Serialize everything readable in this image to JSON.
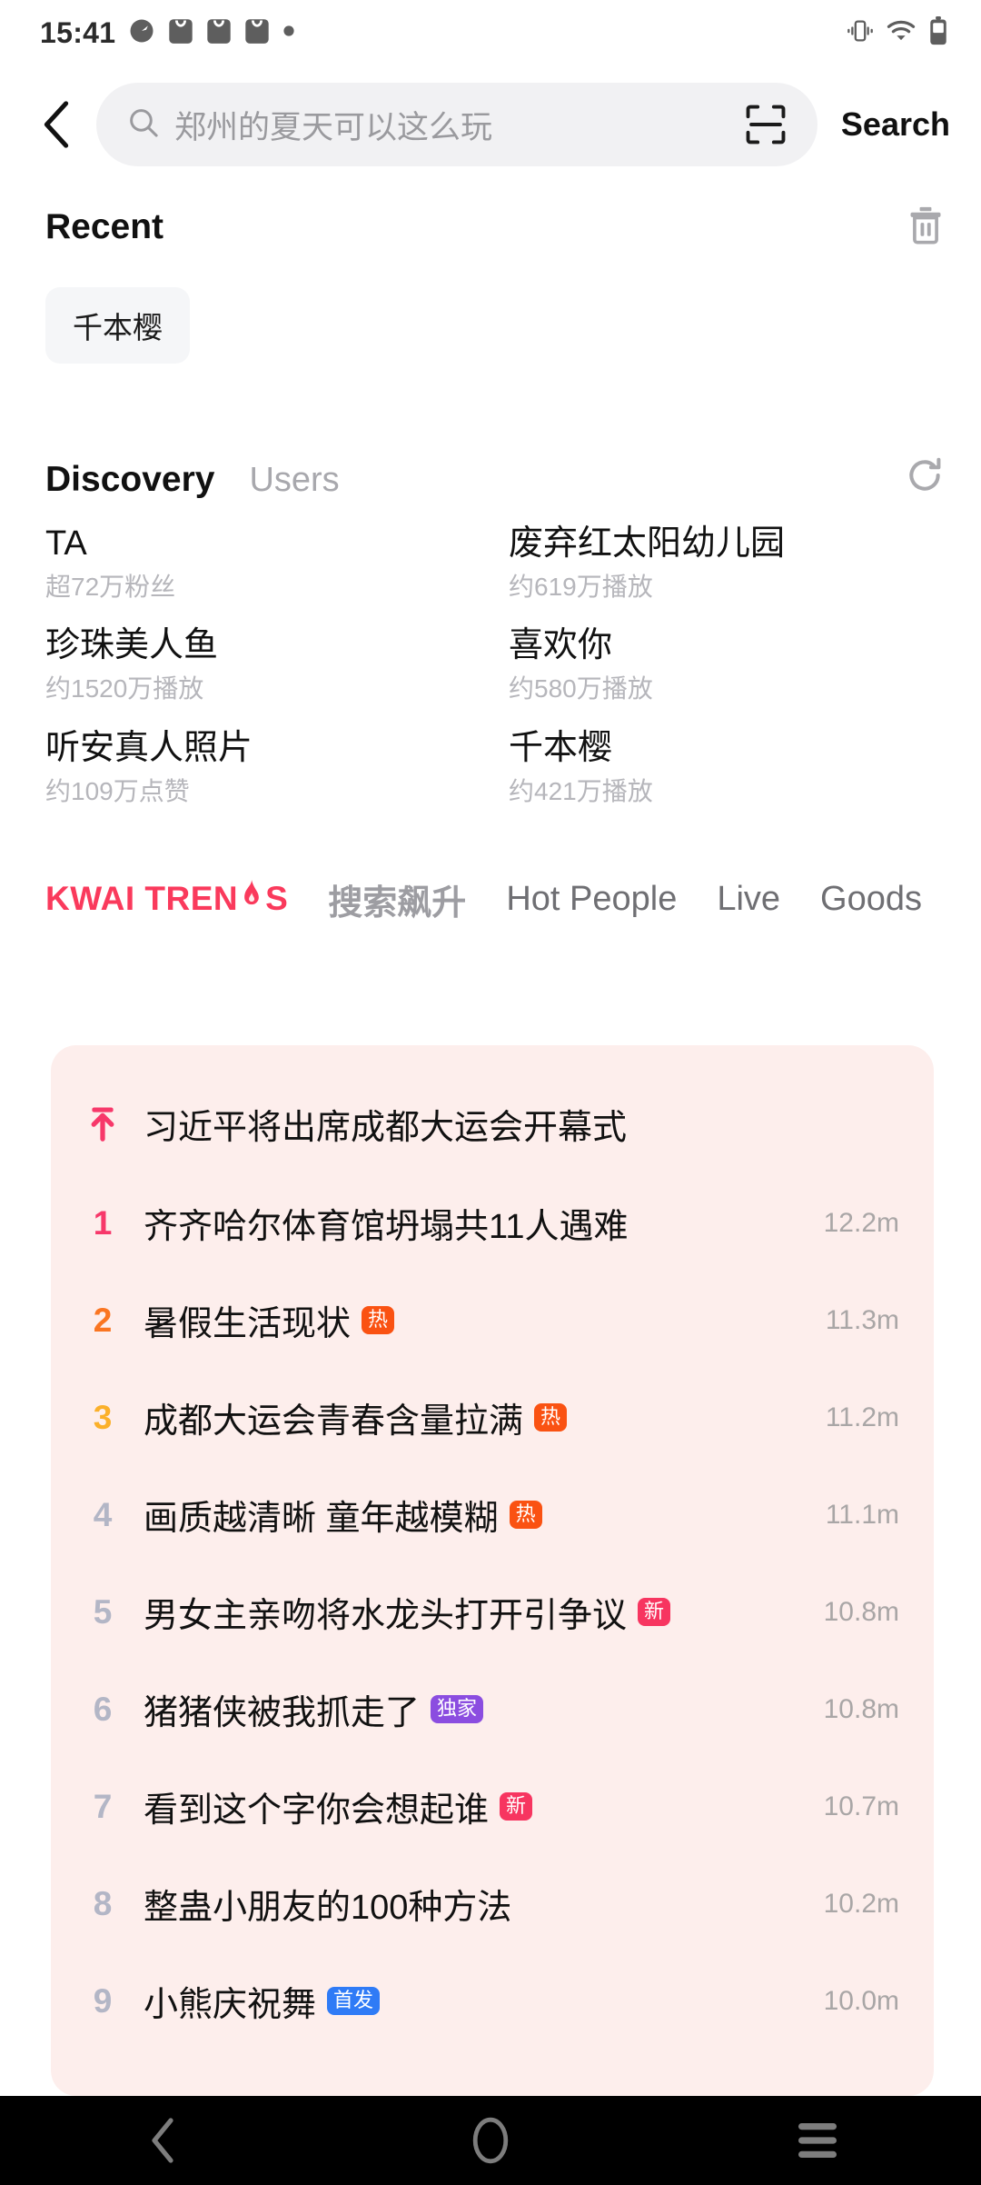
{
  "statusbar": {
    "time": "15:41",
    "left_icons": [
      "speedometer-icon",
      "bag-icon",
      "bag-icon",
      "bag-icon",
      "dot-icon"
    ],
    "right_icons": [
      "vibrate-icon",
      "wifi-icon",
      "battery-icon"
    ]
  },
  "header": {
    "back_icon": "chevron-left-icon",
    "search_icon": "search-icon",
    "search_value": "",
    "search_placeholder": "郑州的夏天可以这么玩",
    "scan_icon": "scan-icon",
    "search_button": "Search"
  },
  "recent": {
    "title": "Recent",
    "clear_icon": "trash-icon",
    "chips": [
      "千本樱"
    ]
  },
  "discovery": {
    "tabs": [
      {
        "label": "Discovery",
        "active": true
      },
      {
        "label": "Users",
        "active": false
      }
    ],
    "refresh_icon": "refresh-icon",
    "items": [
      {
        "title": "TA",
        "subtitle": "超72万粉丝"
      },
      {
        "title": "废弃红太阳幼儿园",
        "subtitle": "约619万播放"
      },
      {
        "title": "珍珠美人鱼",
        "subtitle": "约1520万播放"
      },
      {
        "title": "喜欢你",
        "subtitle": "约580万播放"
      },
      {
        "title": "听安真人照片",
        "subtitle": "约109万点赞"
      },
      {
        "title": "千本樱",
        "subtitle": "约421万播放"
      }
    ]
  },
  "trends": {
    "logo": {
      "pre": "KWAI TREN",
      "post": "S",
      "flame_icon": "flame-icon",
      "color": "#fa3a5c"
    },
    "tabs": [
      {
        "label": "搜索飙升",
        "cn": true
      },
      {
        "label": "Hot People",
        "cn": false
      },
      {
        "label": "Live",
        "cn": false
      },
      {
        "label": "Goods",
        "cn": false
      }
    ],
    "card_bg": "#fdeeec",
    "rank_colors": {
      "1": "#f7386a",
      "2": "#fa7521",
      "3": "#fbb02a",
      "4": "#b3b6c6",
      "default": "#b3b6c6"
    },
    "badge_colors": {
      "热": "#fa5212",
      "新": "#f73560",
      "独家": "#8b4de0",
      "首发": "#2f7bf6"
    },
    "items": [
      {
        "rank": "",
        "pinned": true,
        "pin_icon": "pin-top-icon",
        "title": "习近平将出席成都大运会开幕式",
        "badge": "",
        "heat": ""
      },
      {
        "rank": "1",
        "pinned": false,
        "title": "齐齐哈尔体育馆坍塌共11人遇难",
        "badge": "",
        "heat": "12.2m"
      },
      {
        "rank": "2",
        "pinned": false,
        "title": "暑假生活现状",
        "badge": "热",
        "heat": "11.3m"
      },
      {
        "rank": "3",
        "pinned": false,
        "title": "成都大运会青春含量拉满",
        "badge": "热",
        "heat": "11.2m"
      },
      {
        "rank": "4",
        "pinned": false,
        "title": "画质越清晰 童年越模糊",
        "badge": "热",
        "heat": "11.1m"
      },
      {
        "rank": "5",
        "pinned": false,
        "title": "男女主亲吻将水龙头打开引争议",
        "badge": "新",
        "heat": "10.8m"
      },
      {
        "rank": "6",
        "pinned": false,
        "title": "猪猪侠被我抓走了",
        "badge": "独家",
        "heat": "10.8m"
      },
      {
        "rank": "7",
        "pinned": false,
        "title": "看到这个字你会想起谁",
        "badge": "新",
        "heat": "10.7m"
      },
      {
        "rank": "8",
        "pinned": false,
        "title": "整蛊小朋友的100种方法",
        "badge": "",
        "heat": "10.2m"
      },
      {
        "rank": "9",
        "pinned": false,
        "title": "小熊庆祝舞",
        "badge": "首发",
        "heat": "10.0m"
      }
    ]
  },
  "navbar": {
    "back_icon": "nav-back-icon",
    "home_icon": "nav-home-icon",
    "recents_icon": "nav-recents-icon"
  }
}
